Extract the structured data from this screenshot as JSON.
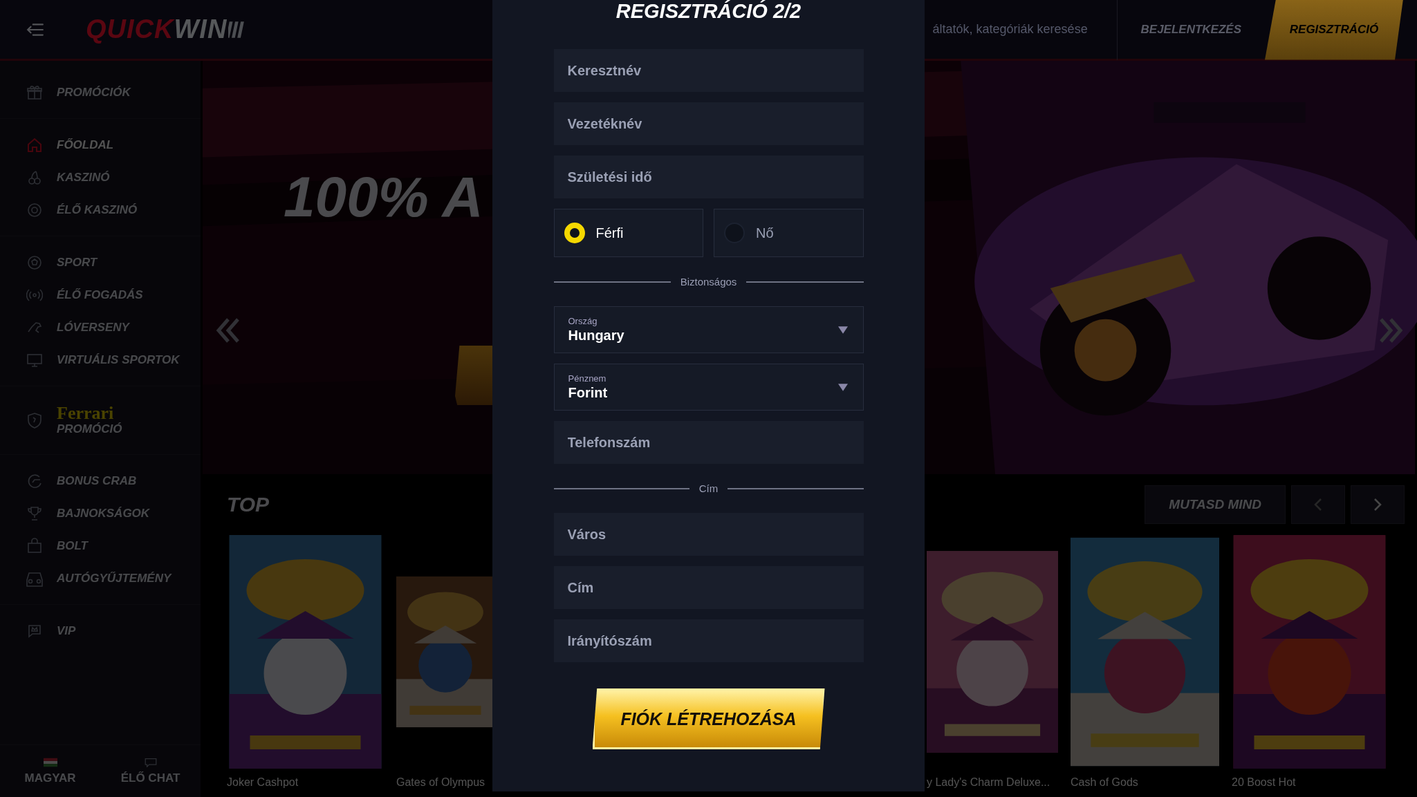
{
  "top_bar": {
    "logo": {
      "part_1": "QUICK",
      "part_2": "WIN"
    },
    "search": {
      "placeholder": "áltatók, kategóriák keresése"
    },
    "login_button": "BEJELENTKEZÉS",
    "register_button": "REGISZTRÁCIÓ"
  },
  "sidebar": {
    "groups": [
      [
        {
          "label": "PROMÓCIÓK",
          "selected": false
        }
      ],
      [
        {
          "label": "FŐOLDAL",
          "selected": true
        },
        {
          "label": "KASZINÓ",
          "selected": false
        },
        {
          "label": "ÉLŐ KASZINÓ",
          "selected": false
        }
      ],
      [
        {
          "label": "SPORT",
          "selected": false
        },
        {
          "label": "ÉLŐ FOGADÁS",
          "selected": false
        },
        {
          "label": "LÓVERSENY",
          "selected": false
        },
        {
          "label": "VIRTUÁLIS SPORTOK",
          "selected": false
        }
      ],
      [
        {
          "brand": "Ferrari",
          "label": "PROMÓCIÓ",
          "selected": false
        }
      ],
      [
        {
          "label": "BONUS CRAB",
          "selected": false
        },
        {
          "label": "BAJNOKSÁGOK",
          "selected": false
        },
        {
          "label": "BOLT",
          "selected": false
        },
        {
          "label": "AUTÓGYŰJTEMÉNY",
          "selected": false
        }
      ],
      [
        {
          "label": "VIP",
          "selected": false
        }
      ]
    ],
    "footer": [
      {
        "label": "MAGYAR"
      },
      {
        "label": "ÉLŐ CHAT"
      }
    ]
  },
  "banner": {
    "headline": "100% A"
  },
  "top_games": {
    "title": "TOP",
    "show_all_button": "MUTASD MIND",
    "games": [
      {
        "name": "Joker Cashpot"
      },
      {
        "name": "Gates of Olympus"
      },
      {
        "name": "y Lady's Charm Deluxe..."
      },
      {
        "name": "Cash of Gods"
      },
      {
        "name": "20 Boost Hot"
      }
    ]
  },
  "registration_modal": {
    "title": "REGISZTRÁCIÓ 2/2",
    "fields": [
      {
        "kind": "text",
        "placeholder": "Keresztnév"
      },
      {
        "kind": "text",
        "placeholder": "Vezetéknév"
      },
      {
        "kind": "text",
        "placeholder": "Születési idő"
      },
      {
        "kind": "radio",
        "options": [
          {
            "label": "Férfi",
            "selected": true
          },
          {
            "label": "Nő",
            "selected": false
          }
        ]
      },
      {
        "kind": "divider",
        "label": "Biztonságos"
      },
      {
        "kind": "select",
        "label": "Ország",
        "value": "Hungary"
      },
      {
        "kind": "select",
        "label": "Pénznem",
        "value": "Forint"
      },
      {
        "kind": "text",
        "placeholder": "Telefonszám"
      },
      {
        "kind": "divider",
        "label": "Cím"
      },
      {
        "kind": "text",
        "placeholder": "Város"
      },
      {
        "kind": "text",
        "placeholder": "Cím"
      },
      {
        "kind": "text",
        "placeholder": "Irányítószám"
      }
    ],
    "submit_button": "FIÓK LÉTREHOZÁSA"
  }
}
